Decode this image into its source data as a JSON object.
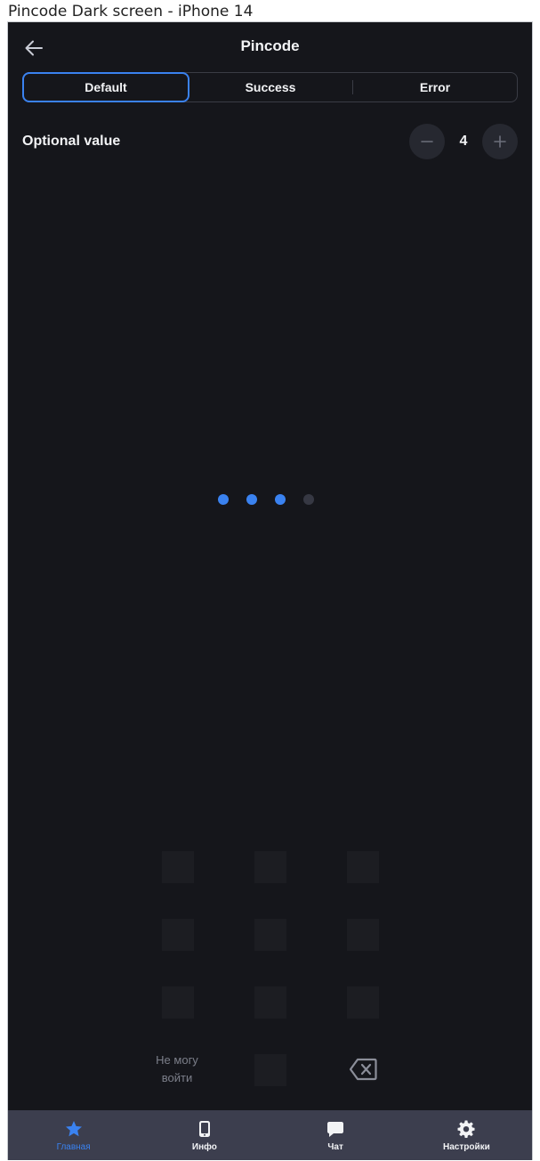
{
  "window": {
    "caption": "Pincode Dark screen - iPhone 14"
  },
  "header": {
    "title": "Pincode",
    "back_icon": "arrow-left-icon"
  },
  "segments": [
    {
      "label": "Default",
      "active": true
    },
    {
      "label": "Success",
      "active": false
    },
    {
      "label": "Error",
      "active": false
    }
  ],
  "optional": {
    "label": "Optional value",
    "value": "4"
  },
  "pincode": {
    "length": 4,
    "filled": 3,
    "accent": "#3a82f0",
    "empty_color": "#363843"
  },
  "keypad": {
    "cant_login_line1": "Не могу",
    "cant_login_line2": "войти",
    "backspace_icon": "backspace-icon"
  },
  "tabbar": {
    "items": [
      {
        "label": "Главная",
        "icon": "star-icon",
        "active": true
      },
      {
        "label": "Инфо",
        "icon": "phone-icon",
        "active": false
      },
      {
        "label": "Чат",
        "icon": "chat-bubble-icon",
        "active": false
      },
      {
        "label": "Настройки",
        "icon": "gear-icon",
        "active": false
      }
    ]
  }
}
